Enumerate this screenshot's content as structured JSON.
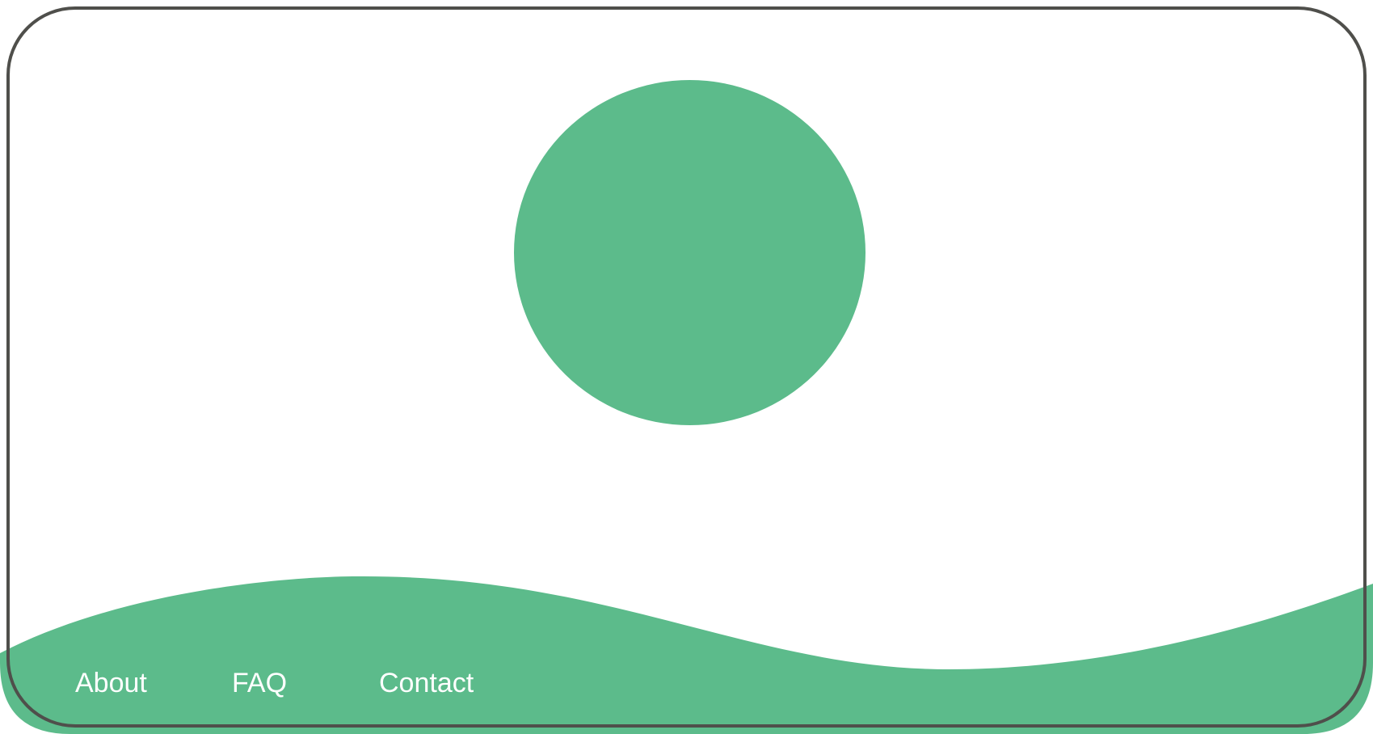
{
  "theme": {
    "accent": "#5cbb8b",
    "frame": "#4f4f4b",
    "background": "#ffffff",
    "nav_text": "#ffffff"
  },
  "hero": {
    "image_icon": "circle-shape"
  },
  "footer_nav": {
    "items": [
      {
        "label": "About"
      },
      {
        "label": "FAQ"
      },
      {
        "label": "Contact"
      }
    ]
  }
}
